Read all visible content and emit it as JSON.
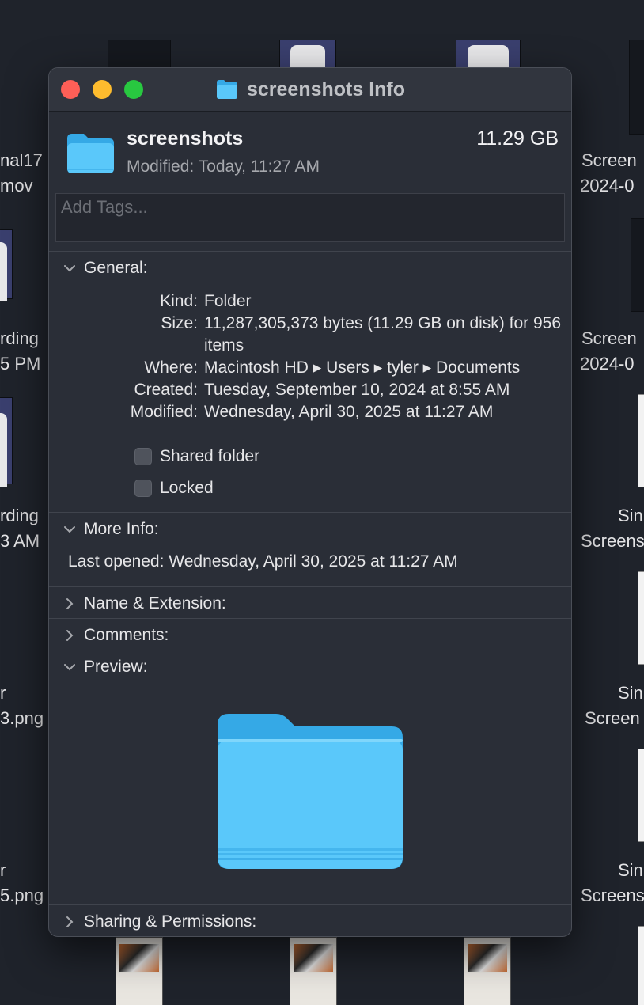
{
  "window": {
    "title": "screenshots Info"
  },
  "header": {
    "name": "screenshots",
    "size": "11.29 GB",
    "modified_label": "Modified:",
    "modified_value": "Today, 11:27 AM"
  },
  "tags": {
    "placeholder": "Add Tags..."
  },
  "general": {
    "title": "General:",
    "rows": [
      {
        "key": "Kind:",
        "value": "Folder"
      },
      {
        "key": "Size:",
        "value": "11,287,305,373 bytes (11.29 GB on disk) for 956 items"
      },
      {
        "key": "Where:",
        "value": "Macintosh HD ▸ Users ▸ tyler ▸ Documents"
      },
      {
        "key": "Created:",
        "value": "Tuesday, September 10, 2024 at 8:55 AM"
      },
      {
        "key": "Modified:",
        "value": "Wednesday, April 30, 2025 at 11:27 AM"
      }
    ],
    "shared_folder_label": "Shared folder",
    "shared_folder_checked": false,
    "locked_label": "Locked",
    "locked_checked": false
  },
  "more_info": {
    "title": "More Info:",
    "last_opened": "Last opened: Wednesday, April 30, 2025 at 11:27 AM"
  },
  "sections": {
    "name_extension": "Name & Extension:",
    "comments": "Comments:",
    "preview": "Preview:",
    "sharing_permissions": "Sharing & Permissions:"
  },
  "desktop_labels": {
    "left": [
      "nal17",
      "mov",
      "rding",
      "5 PM",
      "rding",
      "3 AM",
      "r",
      "3.png",
      "r",
      "5.png"
    ],
    "right": [
      "Screen",
      "2024-0",
      "Screen",
      "2024-0",
      "Sin",
      "Screens",
      "Sin",
      "Screen",
      "Sin",
      "Screens"
    ]
  },
  "colors": {
    "folder_blue": "#5ac8fa",
    "folder_blue_dark": "#35a9e6",
    "close": "#fe5f57",
    "minimize": "#febc2e",
    "maximize": "#28c840"
  }
}
